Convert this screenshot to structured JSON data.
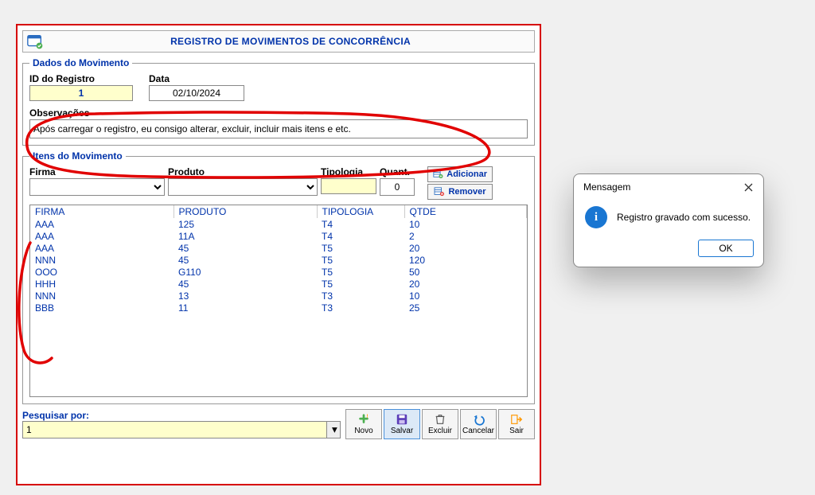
{
  "title": "REGISTRO DE MOVIMENTOS DE CONCORRÊNCIA",
  "dados": {
    "legend": "Dados do Movimento",
    "id_label": "ID do Registro",
    "id_value": "1",
    "data_label": "Data",
    "data_value": "02/10/2024",
    "obs_label": "Observações",
    "obs_value": "Após carregar o registro, eu consigo alterar, excluir, incluir mais itens e etc."
  },
  "itens": {
    "legend": "Itens do Movimento",
    "firma_label": "Firma",
    "produto_label": "Produto",
    "tipologia_label": "Tipologia",
    "quant_label": "Quant.",
    "quant_value": "0",
    "btn_add": "Adicionar",
    "btn_remove": "Remover",
    "cols": {
      "firma": "FIRMA",
      "produto": "PRODUTO",
      "tipologia": "TIPOLOGIA",
      "qtde": "QTDE"
    },
    "rows": [
      {
        "firma": "AAA",
        "produto": "125",
        "tipologia": "T4",
        "qtde": "10"
      },
      {
        "firma": "AAA",
        "produto": "11A",
        "tipologia": "T4",
        "qtde": "2"
      },
      {
        "firma": "AAA",
        "produto": "45",
        "tipologia": "T5",
        "qtde": "20"
      },
      {
        "firma": "NNN",
        "produto": "45",
        "tipologia": "T5",
        "qtde": "120"
      },
      {
        "firma": "OOO",
        "produto": "G110",
        "tipologia": "T5",
        "qtde": "50"
      },
      {
        "firma": "HHH",
        "produto": "45",
        "tipologia": "T5",
        "qtde": "20"
      },
      {
        "firma": "NNN",
        "produto": "13",
        "tipologia": "T3",
        "qtde": "10"
      },
      {
        "firma": "BBB",
        "produto": "11",
        "tipologia": "T3",
        "qtde": "25"
      }
    ]
  },
  "footer": {
    "search_label": "Pesquisar por:",
    "search_value": "1",
    "btns": {
      "novo": "Novo",
      "salvar": "Salvar",
      "excluir": "Excluir",
      "cancelar": "Cancelar",
      "sair": "Sair"
    }
  },
  "dialog": {
    "title": "Mensagem",
    "body": "Registro gravado com sucesso.",
    "ok": "OK"
  }
}
